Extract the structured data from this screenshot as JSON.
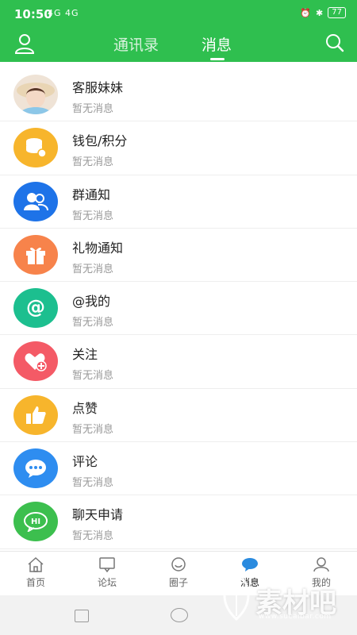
{
  "status_bar": {
    "time": "10:50",
    "network": "4G 4G",
    "battery": "77"
  },
  "header": {
    "tabs": [
      {
        "label": "通讯录",
        "active": false
      },
      {
        "label": "消息",
        "active": true
      }
    ],
    "accent_color": "#2fbf4f"
  },
  "messages": [
    {
      "title": "客服妹妹",
      "subtitle": "暂无消息",
      "icon": "customer-service-photo",
      "color": "#f0d9c2"
    },
    {
      "title": "钱包/积分",
      "subtitle": "暂无消息",
      "icon": "wallet-coins-icon",
      "color": "#f7b52c"
    },
    {
      "title": "群通知",
      "subtitle": "暂无消息",
      "icon": "group-people-icon",
      "color": "#1e73e8"
    },
    {
      "title": "礼物通知",
      "subtitle": "暂无消息",
      "icon": "gift-icon",
      "color": "#f7834b"
    },
    {
      "title": "@我的",
      "subtitle": "暂无消息",
      "icon": "at-icon",
      "color": "#1cbf8f"
    },
    {
      "title": "关注",
      "subtitle": "暂无消息",
      "icon": "heart-plus-icon",
      "color": "#f45a66"
    },
    {
      "title": "点赞",
      "subtitle": "暂无消息",
      "icon": "thumbs-up-icon",
      "color": "#f7b52c"
    },
    {
      "title": "评论",
      "subtitle": "暂无消息",
      "icon": "comment-icon",
      "color": "#2e8df0"
    },
    {
      "title": "聊天申请",
      "subtitle": "暂无消息",
      "icon": "hi-chat-icon",
      "color": "#3cbf4e",
      "icon_text": "HI"
    }
  ],
  "bottom_tabs": [
    {
      "label": "首页",
      "icon": "home-icon",
      "active": false
    },
    {
      "label": "论坛",
      "icon": "forum-icon",
      "active": false
    },
    {
      "label": "圈子",
      "icon": "circle-icon",
      "active": false
    },
    {
      "label": "消息",
      "icon": "message-icon",
      "active": true
    },
    {
      "label": "我的",
      "icon": "profile-icon",
      "active": false
    }
  ],
  "watermark": {
    "text": "素材吧",
    "url": "www.sucaibar.com"
  }
}
